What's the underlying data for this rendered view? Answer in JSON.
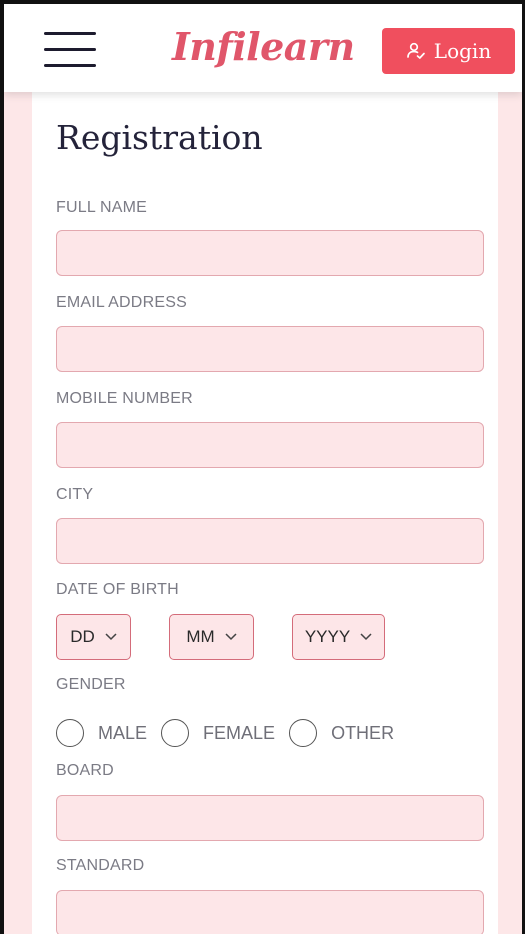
{
  "header": {
    "logo": "Infilearn",
    "login_label": "Login",
    "menu_icon": "hamburger-menu-icon",
    "login_icon": "user-check-icon"
  },
  "form": {
    "title": "Registration",
    "fields": {
      "full_name": "FULL NAME",
      "email": "EMAIL ADDRESS",
      "mobile": "MOBILE NUMBER",
      "city": "CITY",
      "dob": "DATE OF BIRTH",
      "gender": "GENDER",
      "board": "BOARD",
      "standard": "STANDARD"
    },
    "dob_selects": {
      "day": "DD",
      "month": "MM",
      "year": "YYYY"
    },
    "gender_options": {
      "male": "MALE",
      "female": "FEMALE",
      "other": "OTHER"
    }
  },
  "colors": {
    "accent": "#f04f5e",
    "logo": "#e0566a",
    "page_bg": "#fde7e8",
    "input_bg": "#fde6e8"
  }
}
